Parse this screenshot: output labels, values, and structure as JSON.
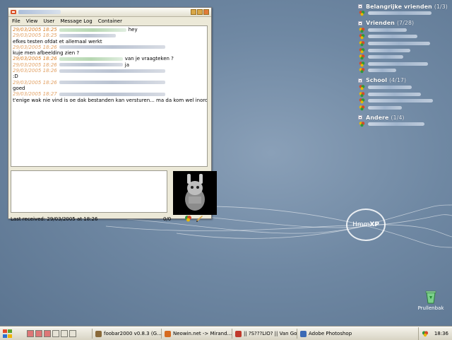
{
  "chat_window": {
    "menu": [
      "File",
      "View",
      "User",
      "Message Log",
      "Container"
    ],
    "messages": [
      {
        "time": "29/03/2005 18:25",
        "text": "hey",
        "ts_alt": false
      },
      {
        "time": "29/03/2005 18:25",
        "text": "",
        "ts_alt": true
      },
      {
        "time": "",
        "text": "efkes testen ofdat et allemaal werkt",
        "ts_alt": false
      },
      {
        "time": "29/03/2005 18:26",
        "text": "",
        "ts_alt": true
      },
      {
        "time": "",
        "text": "kuje men afbeelding zien ?",
        "ts_alt": false
      },
      {
        "time": "29/03/2005 18:26",
        "text": "van je vraagteken ?",
        "ts_alt": false
      },
      {
        "time": "29/03/2005 18:26",
        "text": "ja",
        "ts_alt": true
      },
      {
        "time": "29/03/2005 18:26",
        "text": "",
        "ts_alt": true
      },
      {
        "time": "",
        "text": ":D",
        "ts_alt": false
      },
      {
        "time": "29/03/2005 18:26",
        "text": "",
        "ts_alt": true
      },
      {
        "time": "",
        "text": "goed",
        "ts_alt": false
      },
      {
        "time": "29/03/2005 18:27",
        "text": "",
        "ts_alt": true
      },
      {
        "time": "",
        "text": "t'enige wak nie vind is oe dak bestanden kan versturen... ma da kom wel inorde",
        "ts_alt": false
      }
    ],
    "status_text": "Last received: 29/03/2005 at 18:26",
    "char_count": "0/0"
  },
  "contact_list": {
    "groups": [
      {
        "name": "Belangrijke vrienden",
        "count": "(1/3)",
        "contacts": 1
      },
      {
        "name": "Vrienden",
        "count": "(7/28)",
        "contacts": 7
      },
      {
        "name": "School",
        "count": "(4/17)",
        "contacts": 4
      },
      {
        "name": "Andere",
        "count": "(1/4)",
        "contacts": 1
      }
    ]
  },
  "desktop": {
    "logo_prefix": "Hmm",
    "logo_suffix": "XP",
    "trash_label": "Prullenbak"
  },
  "taskbar": {
    "tasks": [
      {
        "label": "foobar2000 v0.8.3 (G...",
        "icon": "foobar-icon",
        "color": "#8a6a3a"
      },
      {
        "label": "Neowin.net -> Mirand...",
        "icon": "firefox-icon",
        "color": "#d66a1e"
      },
      {
        "label": "|| ?S???LIO? || Van Go...",
        "icon": "miranda-icon",
        "color": "#c0392b"
      },
      {
        "label": "Adobe Photoshop",
        "icon": "photoshop-icon",
        "color": "#3b6ab5"
      }
    ],
    "clock": "18:36"
  },
  "colors": {
    "timestamp": "#d9822b",
    "desktop": "#6f88a3"
  }
}
